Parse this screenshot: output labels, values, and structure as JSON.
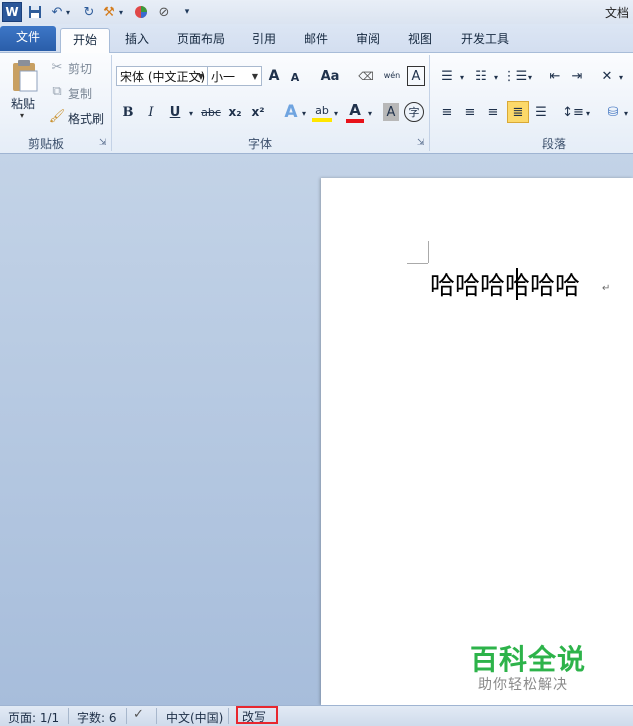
{
  "titlebar": {
    "app_logo": "W",
    "title": "文档",
    "quick_access_icons": [
      "save-icon",
      "undo-icon",
      "redo-icon",
      "format-painter-icon",
      "color-icon",
      "edit-icon",
      "customize-icon"
    ]
  },
  "tabs": [
    "文件",
    "开始",
    "插入",
    "页面布局",
    "引用",
    "邮件",
    "审阅",
    "视图",
    "开发工具"
  ],
  "clipboard": {
    "paste": "粘贴",
    "cut": "剪切",
    "copy": "复制",
    "format_painter": "格式刷",
    "group": "剪贴板"
  },
  "font": {
    "font_name": "宋体 (中文正文)",
    "font_size": "小一",
    "grow": "A",
    "shrink": "A",
    "change_case": "Aa",
    "phonetic": "wén",
    "char_border": "A",
    "bold": "B",
    "italic": "I",
    "underline": "U",
    "strikethrough": "abc",
    "subscript": "x₂",
    "superscript": "x²",
    "text_effect": "A",
    "highlight": "ab",
    "font_color": "A",
    "char_shading": "A",
    "enclose": "字",
    "group": "字体"
  },
  "paragraph": {
    "group": "段落"
  },
  "document": {
    "text": "哈哈哈哈哈哈",
    "paragraph_mark": "↵"
  },
  "watermark": {
    "title": "百科全说",
    "subtitle": "助你轻松解决"
  },
  "status": {
    "page": "页面: 1/1",
    "words": "字数: 6",
    "language": "中文(中国)",
    "overtype": "改写"
  },
  "colors": {
    "file_tab": "#2a5ea9",
    "highlight_box": "#e8272f",
    "watermark": "#2db34a"
  }
}
